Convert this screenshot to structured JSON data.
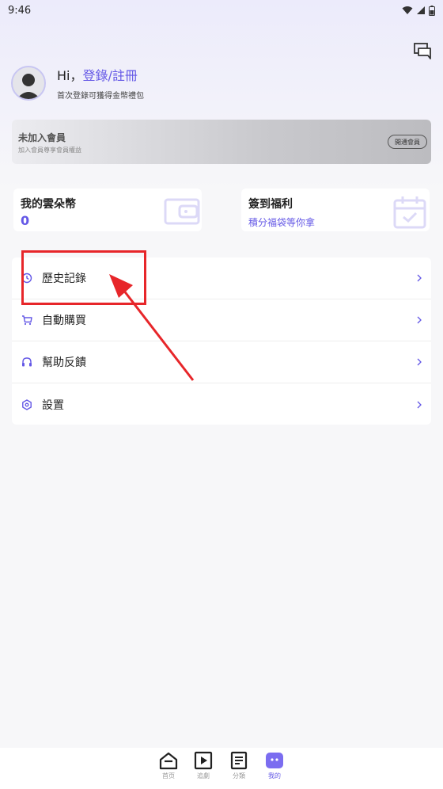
{
  "status_bar": {
    "time": "9:46"
  },
  "profile": {
    "greeting": "Hi，",
    "login_link": "登錄/註冊",
    "subtitle": "首次登錄可獲得金幣禮包"
  },
  "vip_card": {
    "title": "未加入會員",
    "subtitle": "加入會員尊享會員權益",
    "button": "開通會員"
  },
  "coins_card": {
    "title": "我的雲朵幣",
    "value": "0"
  },
  "checkin_card": {
    "title": "簽到福利",
    "subtitle": "積分福袋等你拿"
  },
  "menu": {
    "items": [
      {
        "label": "歷史記錄",
        "icon": "clock-icon"
      },
      {
        "label": "自動購買",
        "icon": "cart-icon"
      },
      {
        "label": "幫助反饋",
        "icon": "headset-icon"
      },
      {
        "label": "設置",
        "icon": "hexagon-settings-icon"
      }
    ]
  },
  "tabs": [
    {
      "label": "首页",
      "icon": "home-icon"
    },
    {
      "label": "追劇",
      "icon": "play-icon"
    },
    {
      "label": "分類",
      "icon": "list-icon"
    },
    {
      "label": "我的",
      "icon": "profile-face-icon"
    }
  ],
  "colors": {
    "accent": "#6458e6",
    "annotation": "#e7262a",
    "background": "#f7f7f9"
  }
}
